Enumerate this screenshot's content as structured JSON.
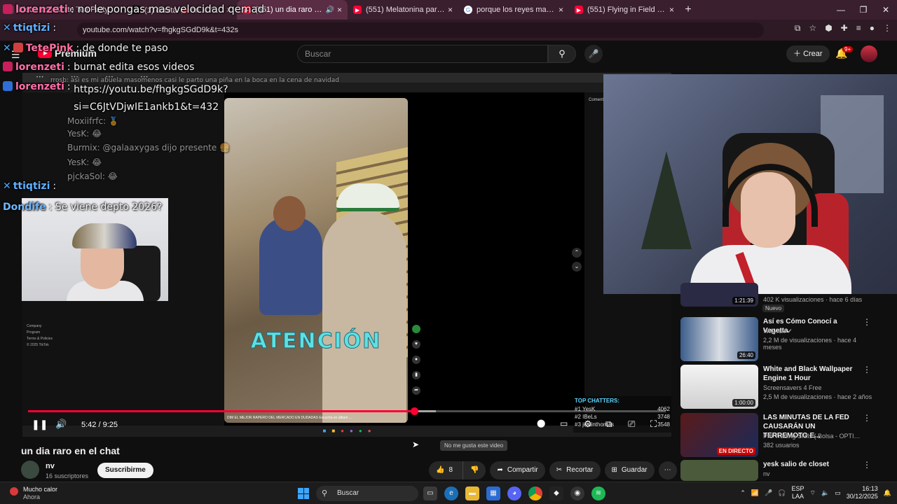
{
  "browser": {
    "tabs": [
      {
        "title": "Black and White Tea Party (Orig",
        "icon": "music-icon",
        "active": false
      },
      {
        "title": "(1) danita 🐞 on X: \"Chamuyan",
        "icon": "x-icon",
        "active": false
      },
      {
        "title": "(551) un dia raro en el chat",
        "icon": "youtube-icon",
        "active": true
      },
      {
        "title": "(551) Melatonina para dormir, ",
        "icon": "youtube-icon",
        "active": false
      },
      {
        "title": "porque los reyes magos llegan",
        "icon": "google-icon",
        "active": false
      },
      {
        "title": "(551) Flying in Field of Tiny Rob",
        "icon": "youtube-icon",
        "active": false
      }
    ],
    "url": "youtube.com/watch?v=fhgkgSGdD9k&t=432s"
  },
  "youtube": {
    "logo_text": "Premium",
    "search_placeholder": "Buscar",
    "create_label": "Crear",
    "notifications": "9+"
  },
  "chat": [
    {
      "user": "lorenzeti",
      "text": "no le pongas mas velocidad qemad"
    },
    {
      "user": "ttiqtizi",
      "text": ""
    },
    {
      "user": "TetePink",
      "text": "de donde te paso"
    },
    {
      "user": "lorenzeti",
      "text": "burnat edita esos videos"
    },
    {
      "user": "lorenzeti",
      "text": "https://youtu.be/fhgkgSGdD9k?si=C6JtVDjwIE1ankb1&t=432"
    },
    {
      "user": "ttiqtizi",
      "text": ""
    },
    {
      "user": "Dondife",
      "text": "Se viene depto 2026?"
    }
  ],
  "inner_stream": {
    "messages": [
      "rrosb: asi es mi abuela masomenos casi le parto una piña en la boca en la cena de navidad",
      "Moxiifrfc: 🏅",
      "YesK: 😂",
      "Burmix: @galaaxygas dijo presente 🍔",
      "YesK: 😂",
      "pjckaSol: 😂"
    ],
    "tiktok_footer": [
      "Company",
      "Program",
      "Terms & Policies",
      "© 2025 TikTok"
    ],
    "comments_label": "Comentarios",
    "overlay_text": "ATENCIÓN",
    "caption": "DIM EL MEJOR RAPERO DEL MERCADO EN DUDADAS Escucha en álbum ...",
    "top_chatters_title": "TOP CHATTERS:",
    "top_chatters": [
      {
        "name": "#1 YesK",
        "count": "4062"
      },
      {
        "name": "#2 IBeLs",
        "count": "3748"
      },
      {
        "name": "#3 justinthomas",
        "count": "3548"
      }
    ]
  },
  "player": {
    "time_current": "5:42",
    "time_total": "9:25",
    "progress": 0.6053,
    "buffered": 0.64
  },
  "video": {
    "title": "un dia raro en el chat",
    "channel": "nv",
    "subscribers": "16 suscriptores",
    "subscribe_label": "Suscribirme",
    "likes": "8",
    "share_label": "Compartir",
    "clip_label": "Recortar",
    "save_label": "Guardar",
    "tooltip": "No me gusta este video"
  },
  "related": [
    {
      "title": "",
      "channel": "",
      "meta": "402 K visualizaciones · hace 6 días",
      "duration": "1:21:39",
      "badge": "Nuevo"
    },
    {
      "title": "Así es Cómo Conocí a Vegetta",
      "channel": "Willyrex",
      "meta": "2,2 M de visualizaciones · hace 4 meses",
      "duration": "26:40"
    },
    {
      "title": "White and Black Wallpaper Engine 1 Hour",
      "channel": "Screensavers 4 Free",
      "meta": "2,5 M de visualizaciones · hace 2 años",
      "duration": "1:00:00"
    },
    {
      "title": "LAS MINUTAS DE LA FED CAUSARÁN UN TERREMOTO E...",
      "channel": "Pro Trading Skills ( Bolsa - OPTIONS - Cr...",
      "meta": "382 usuarios",
      "duration": "EN DIRECTO"
    },
    {
      "title": "yesk salio de closet",
      "channel": "nv",
      "meta": "",
      "duration": ""
    }
  ],
  "taskbar": {
    "weather_title": "Mucho calor",
    "weather_sub": "Ahora",
    "search_placeholder": "Buscar",
    "lang_top": "ESP",
    "lang_bottom": "LAA",
    "time": "16:13",
    "date": "30/12/2025"
  }
}
